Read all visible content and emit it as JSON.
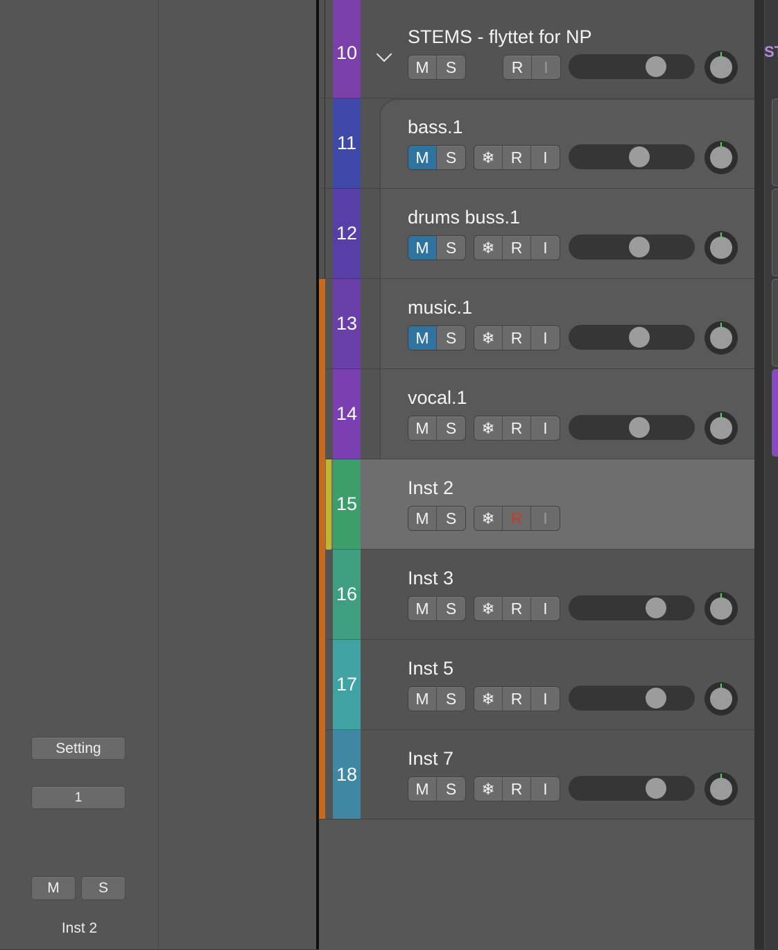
{
  "inspector": {
    "setting_label": "Setting",
    "channel_value": "1",
    "mute_label": "M",
    "solo_label": "S",
    "track_name": "Inst 2"
  },
  "arrange": {
    "stems_label": "ST"
  },
  "tracks": [
    {
      "number": "10",
      "name": "STEMS - flyttet for NP",
      "color": "#7a3fa8",
      "type": "folder",
      "mute": "M",
      "solo": "S",
      "record": "R",
      "input": "I"
    },
    {
      "number": "11",
      "name": "bass.1",
      "color": "#3f49a8",
      "mute": "M",
      "solo": "S",
      "freeze": "❄",
      "record": "R",
      "input": "I",
      "muted": true
    },
    {
      "number": "12",
      "name": "drums buss.1",
      "color": "#583fa8",
      "mute": "M",
      "solo": "S",
      "freeze": "❄",
      "record": "R",
      "input": "I",
      "muted": true
    },
    {
      "number": "13",
      "name": "music.1",
      "color": "#6a3fa8",
      "mute": "M",
      "solo": "S",
      "freeze": "❄",
      "record": "R",
      "input": "I",
      "muted": true
    },
    {
      "number": "14",
      "name": "vocal.1",
      "color": "#7a3fb0",
      "mute": "M",
      "solo": "S",
      "freeze": "❄",
      "record": "R",
      "input": "I"
    },
    {
      "number": "15",
      "name": "Inst 2",
      "color": "#3e9e6b",
      "mute": "M",
      "solo": "S",
      "freeze": "❄",
      "record": "R",
      "input": "I",
      "selected": true,
      "record_armed": true
    },
    {
      "number": "16",
      "name": "Inst 3",
      "color": "#3f9e80",
      "mute": "M",
      "solo": "S",
      "freeze": "❄",
      "record": "R",
      "input": "I"
    },
    {
      "number": "17",
      "name": "Inst 5",
      "color": "#3fa3a3",
      "mute": "M",
      "solo": "S",
      "freeze": "❄",
      "record": "R",
      "input": "I"
    },
    {
      "number": "18",
      "name": "Inst 7",
      "color": "#3f87a3",
      "mute": "M",
      "solo": "S",
      "freeze": "❄",
      "record": "R",
      "input": "I"
    }
  ],
  "volume_levels_percent": [
    69,
    56,
    56,
    56,
    56,
    null,
    69,
    69,
    69
  ],
  "pan": "center",
  "pan_indicator_color": "#4fd65a"
}
